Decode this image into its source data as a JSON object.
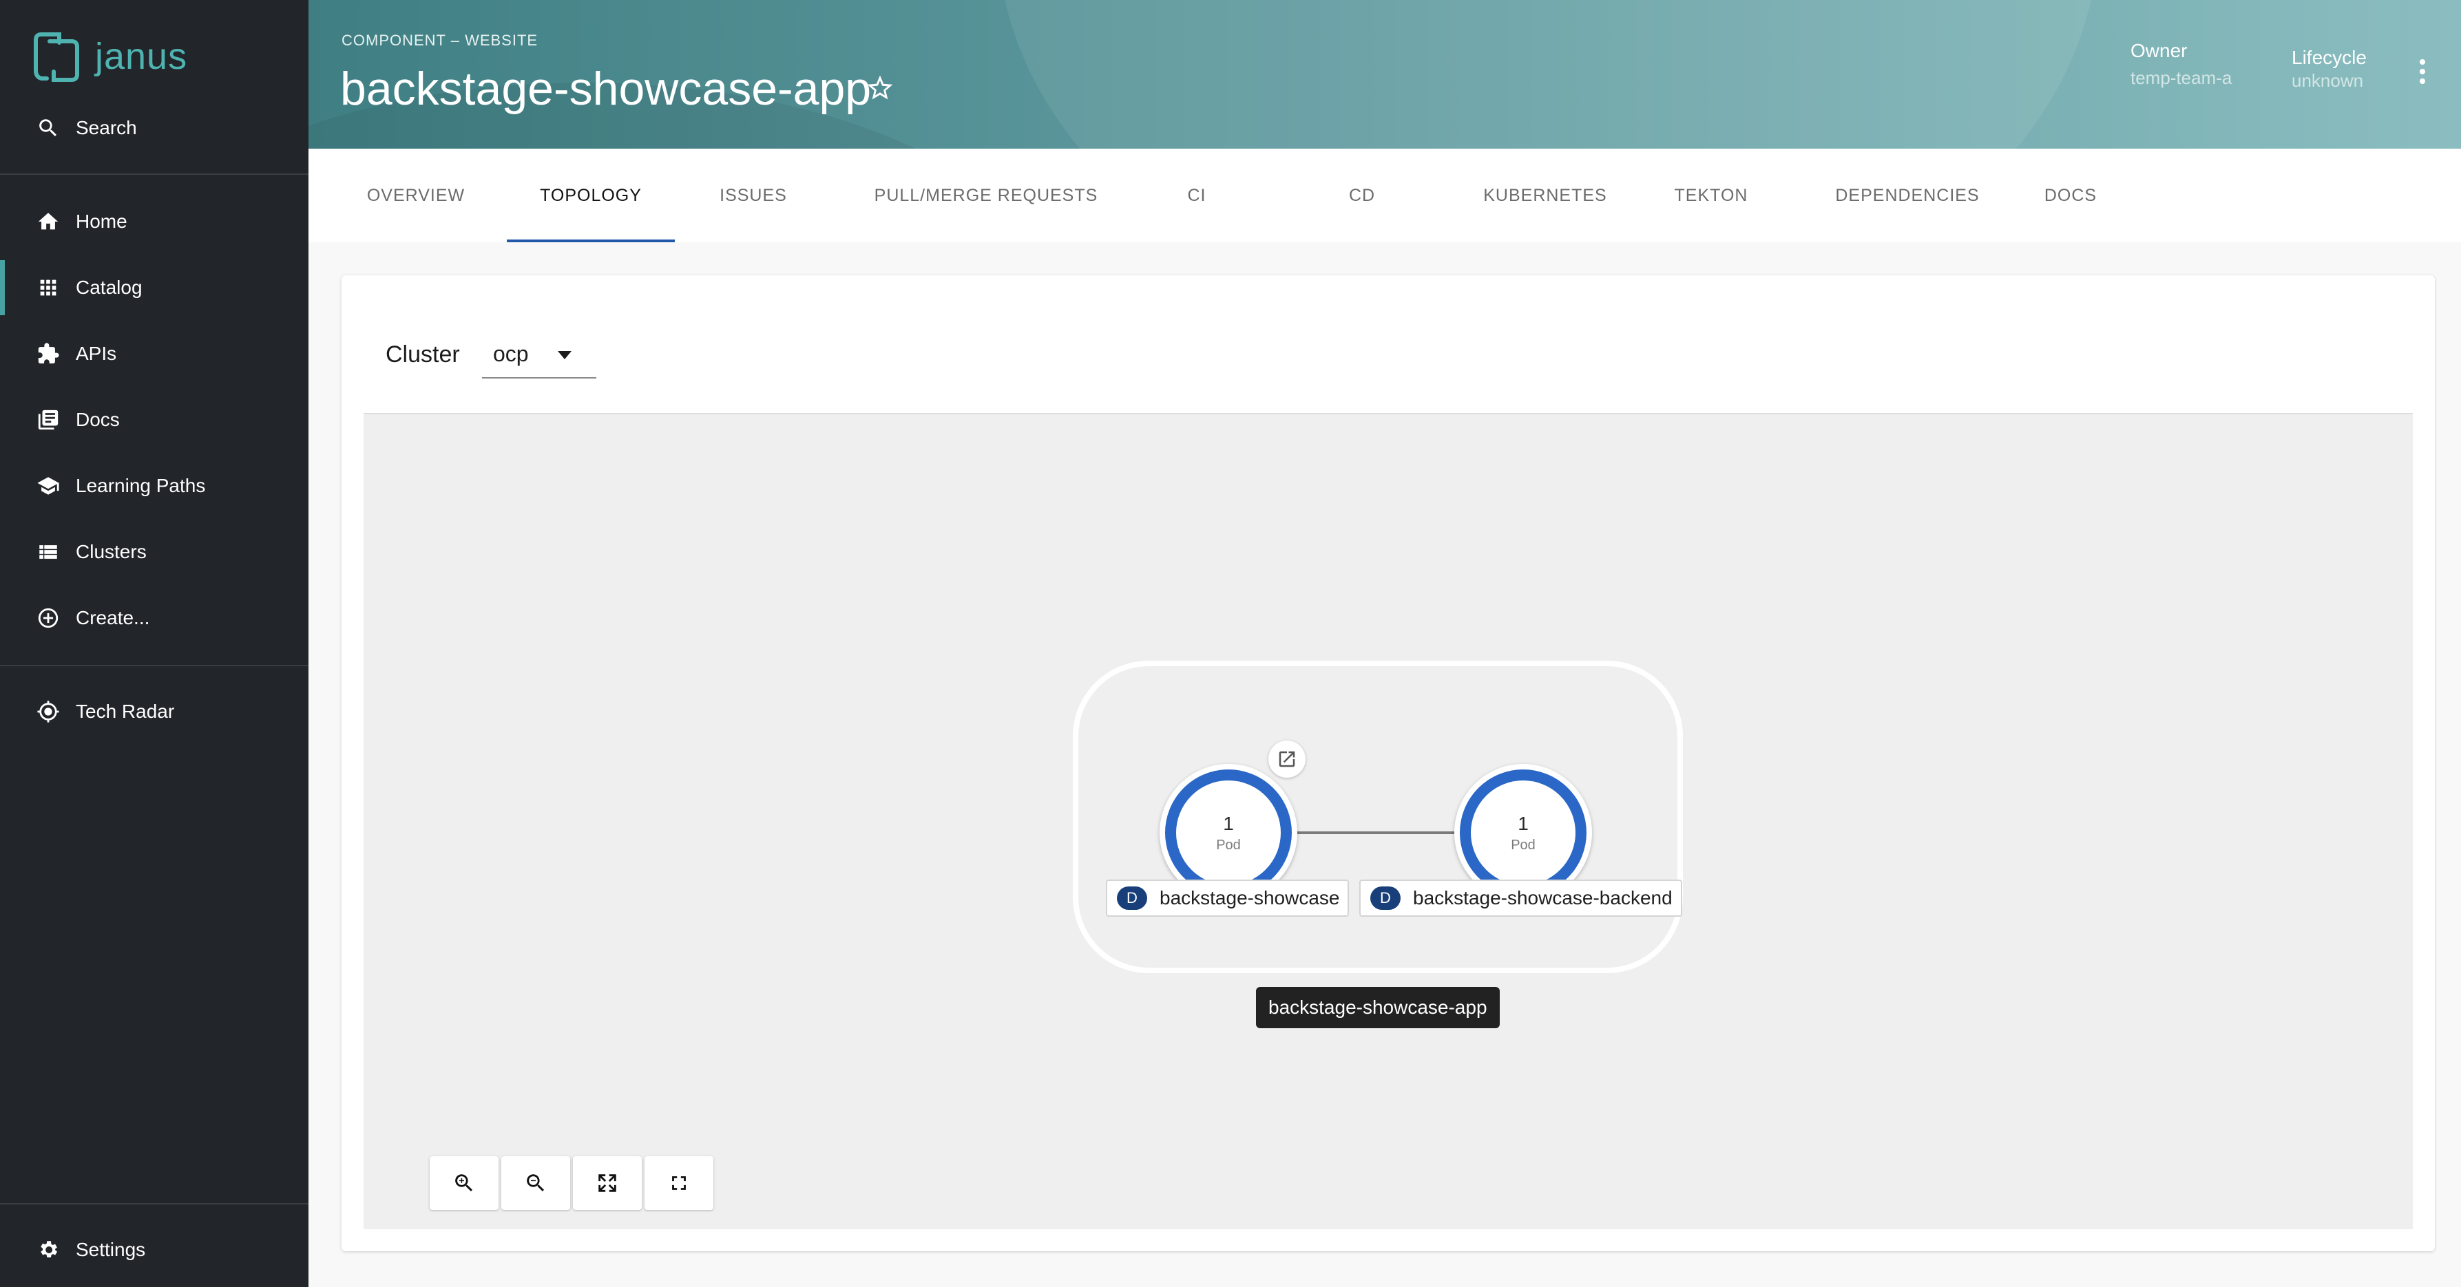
{
  "sidebar": {
    "logo_text": "janus",
    "search_label": "Search",
    "items": [
      {
        "label": "Home",
        "icon": "home-icon"
      },
      {
        "label": "Catalog",
        "icon": "grid-icon"
      },
      {
        "label": "APIs",
        "icon": "puzzle-icon"
      },
      {
        "label": "Docs",
        "icon": "docs-icon"
      },
      {
        "label": "Learning Paths",
        "icon": "school-icon"
      },
      {
        "label": "Clusters",
        "icon": "list-icon"
      },
      {
        "label": "Create...",
        "icon": "add-circle-icon"
      },
      {
        "label": "Tech Radar",
        "icon": "radar-icon"
      }
    ],
    "settings_label": "Settings"
  },
  "header": {
    "kicker": "COMPONENT – WEBSITE",
    "title": "backstage-showcase-app",
    "owner_label": "Owner",
    "owner_value": "temp-team-a",
    "lifecycle_label": "Lifecycle",
    "lifecycle_value": "unknown"
  },
  "tabs": [
    {
      "label": "OVERVIEW"
    },
    {
      "label": "TOPOLOGY"
    },
    {
      "label": "ISSUES"
    },
    {
      "label": "PULL/MERGE REQUESTS"
    },
    {
      "label": "CI"
    },
    {
      "label": "CD"
    },
    {
      "label": "KUBERNETES"
    },
    {
      "label": "TEKTON"
    },
    {
      "label": "DEPENDENCIES"
    },
    {
      "label": "DOCS"
    }
  ],
  "active_tab": "TOPOLOGY",
  "topology": {
    "cluster_label": "Cluster",
    "cluster_value": "ocp",
    "nodes": [
      {
        "count": "1",
        "unit": "Pod",
        "badge": "D",
        "label": "backstage-showcase"
      },
      {
        "count": "1",
        "unit": "Pod",
        "badge": "D",
        "label": "backstage-showcase-backend"
      }
    ],
    "group_label": "backstage-showcase-app"
  },
  "colors": {
    "sidebar_bg": "#222529",
    "accent_teal": "#47a3a2",
    "tab_indicator": "#2258a8",
    "node_ring": "#2a67c6",
    "badge_bg": "#183f7a"
  }
}
